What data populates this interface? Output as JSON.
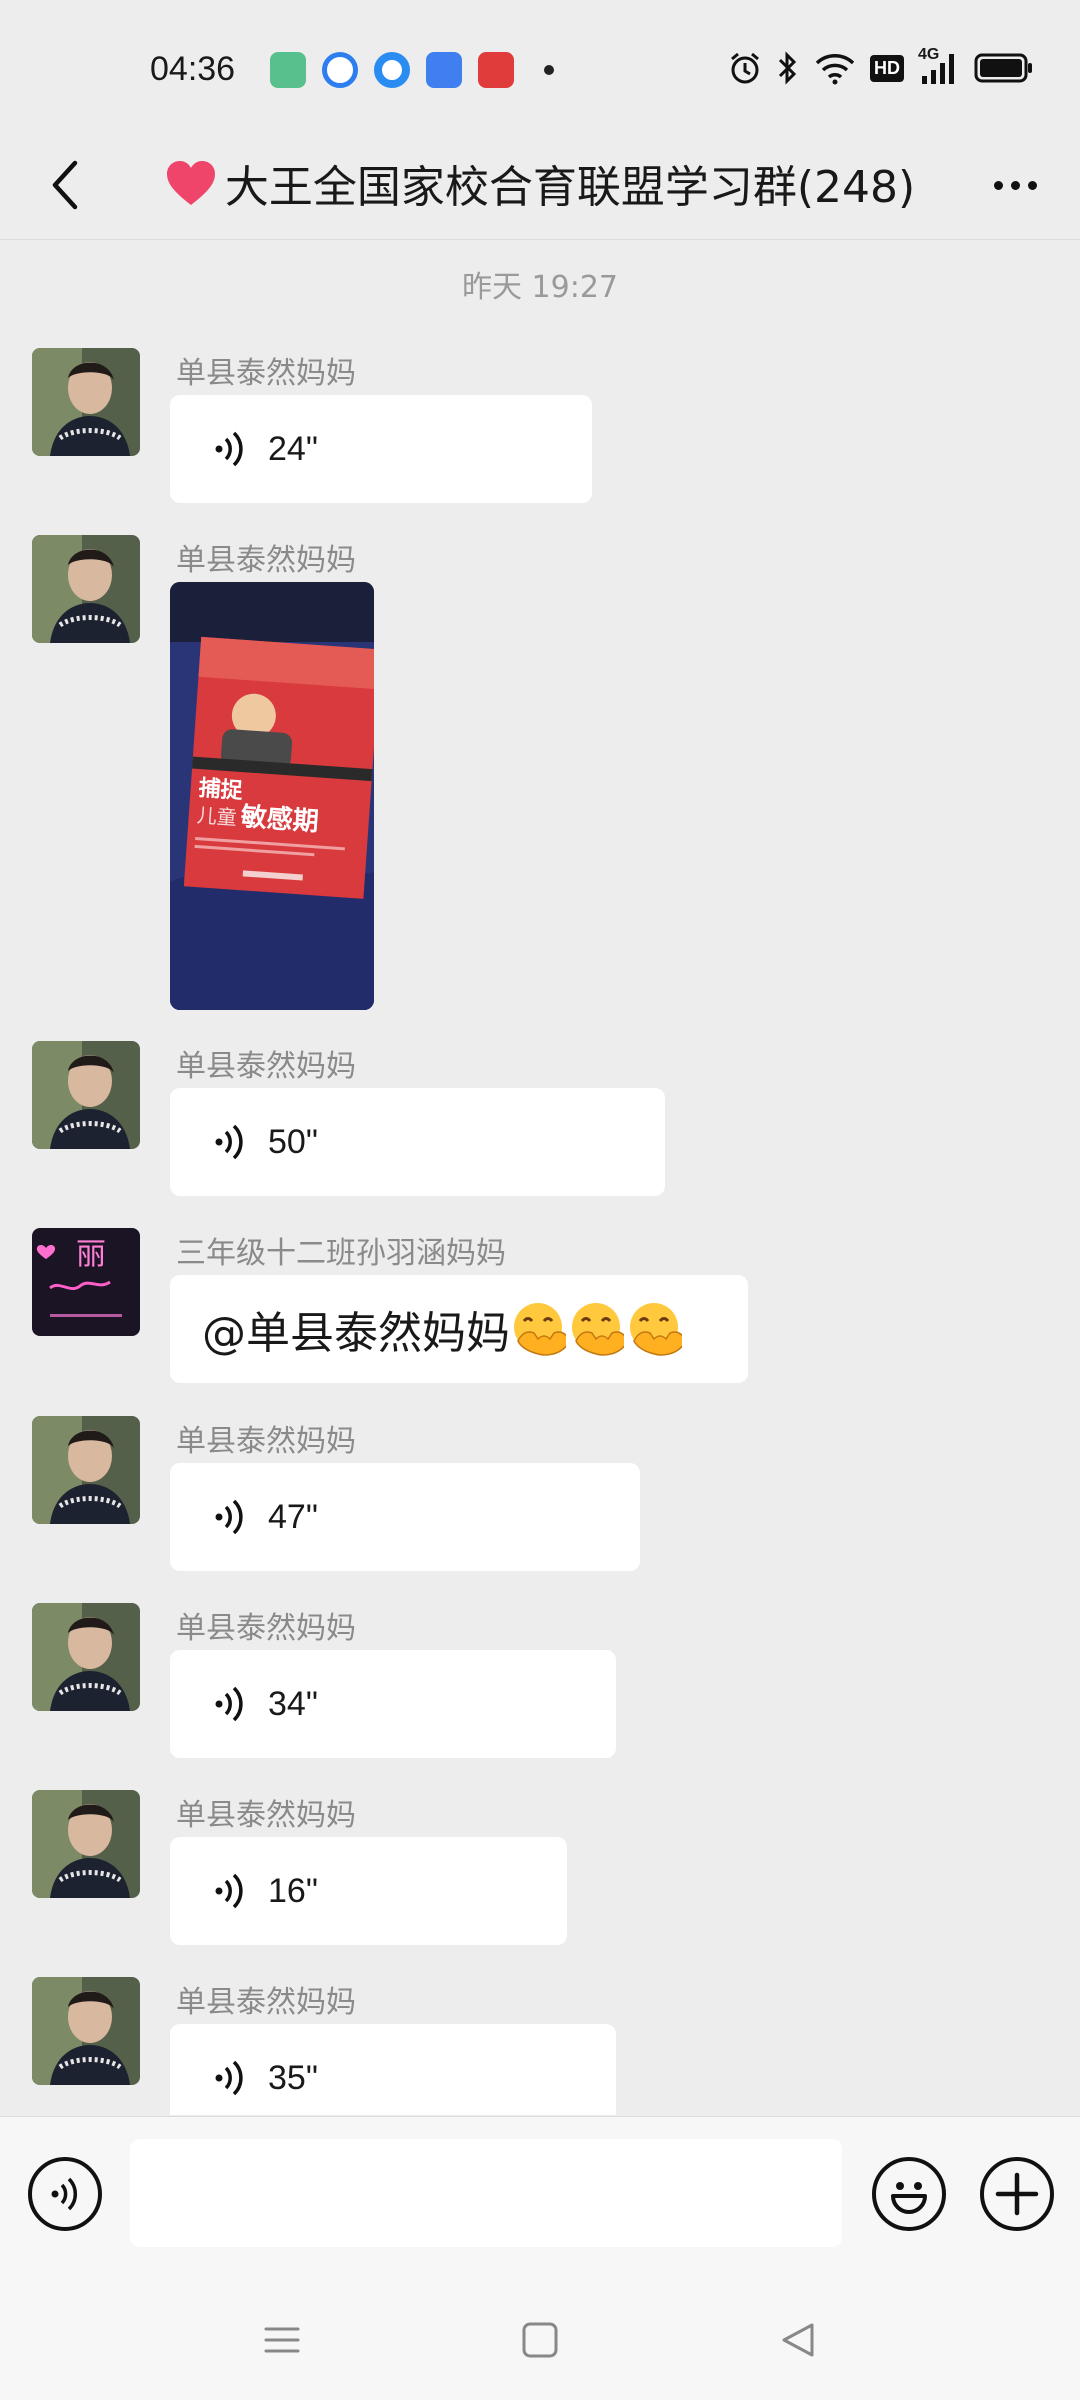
{
  "status_bar": {
    "time": "04:36",
    "network": "4G",
    "hd_label": "HD"
  },
  "header": {
    "title": "大王全国家校合育联盟学习群(248)"
  },
  "chat": {
    "timestamp": "昨天 19:27",
    "messages": [
      {
        "sender": "单县泰然妈妈",
        "type": "voice",
        "duration": "24\""
      },
      {
        "sender": "单县泰然妈妈",
        "type": "image",
        "book_title_line1": "捕捉",
        "book_title_line2a": "儿童",
        "book_title_line2b": "敏感期"
      },
      {
        "sender": "单县泰然妈妈",
        "type": "voice",
        "duration": "50\""
      },
      {
        "sender": "三年级十二班孙羽涵妈妈",
        "type": "text",
        "text": "@单县泰然妈妈 ",
        "avatar_text": "丽"
      },
      {
        "sender": "单县泰然妈妈",
        "type": "voice",
        "duration": "47\""
      },
      {
        "sender": "单县泰然妈妈",
        "type": "voice",
        "duration": "34\""
      },
      {
        "sender": "单县泰然妈妈",
        "type": "voice",
        "duration": "16\""
      },
      {
        "sender": "单县泰然妈妈",
        "type": "voice",
        "duration": "35\""
      }
    ]
  },
  "input_bar": {
    "placeholder": ""
  },
  "colors": {
    "background": "#ededed",
    "bubble": "#ffffff",
    "sender_text": "#8a8a8a",
    "heart": "#f0456a"
  },
  "icons": [
    "back-arrow-icon",
    "more-dots-icon",
    "voice-wave-icon",
    "voice-input-icon",
    "emoji-icon",
    "plus-icon",
    "menu-icon",
    "home-square-icon",
    "back-triangle-icon"
  ]
}
